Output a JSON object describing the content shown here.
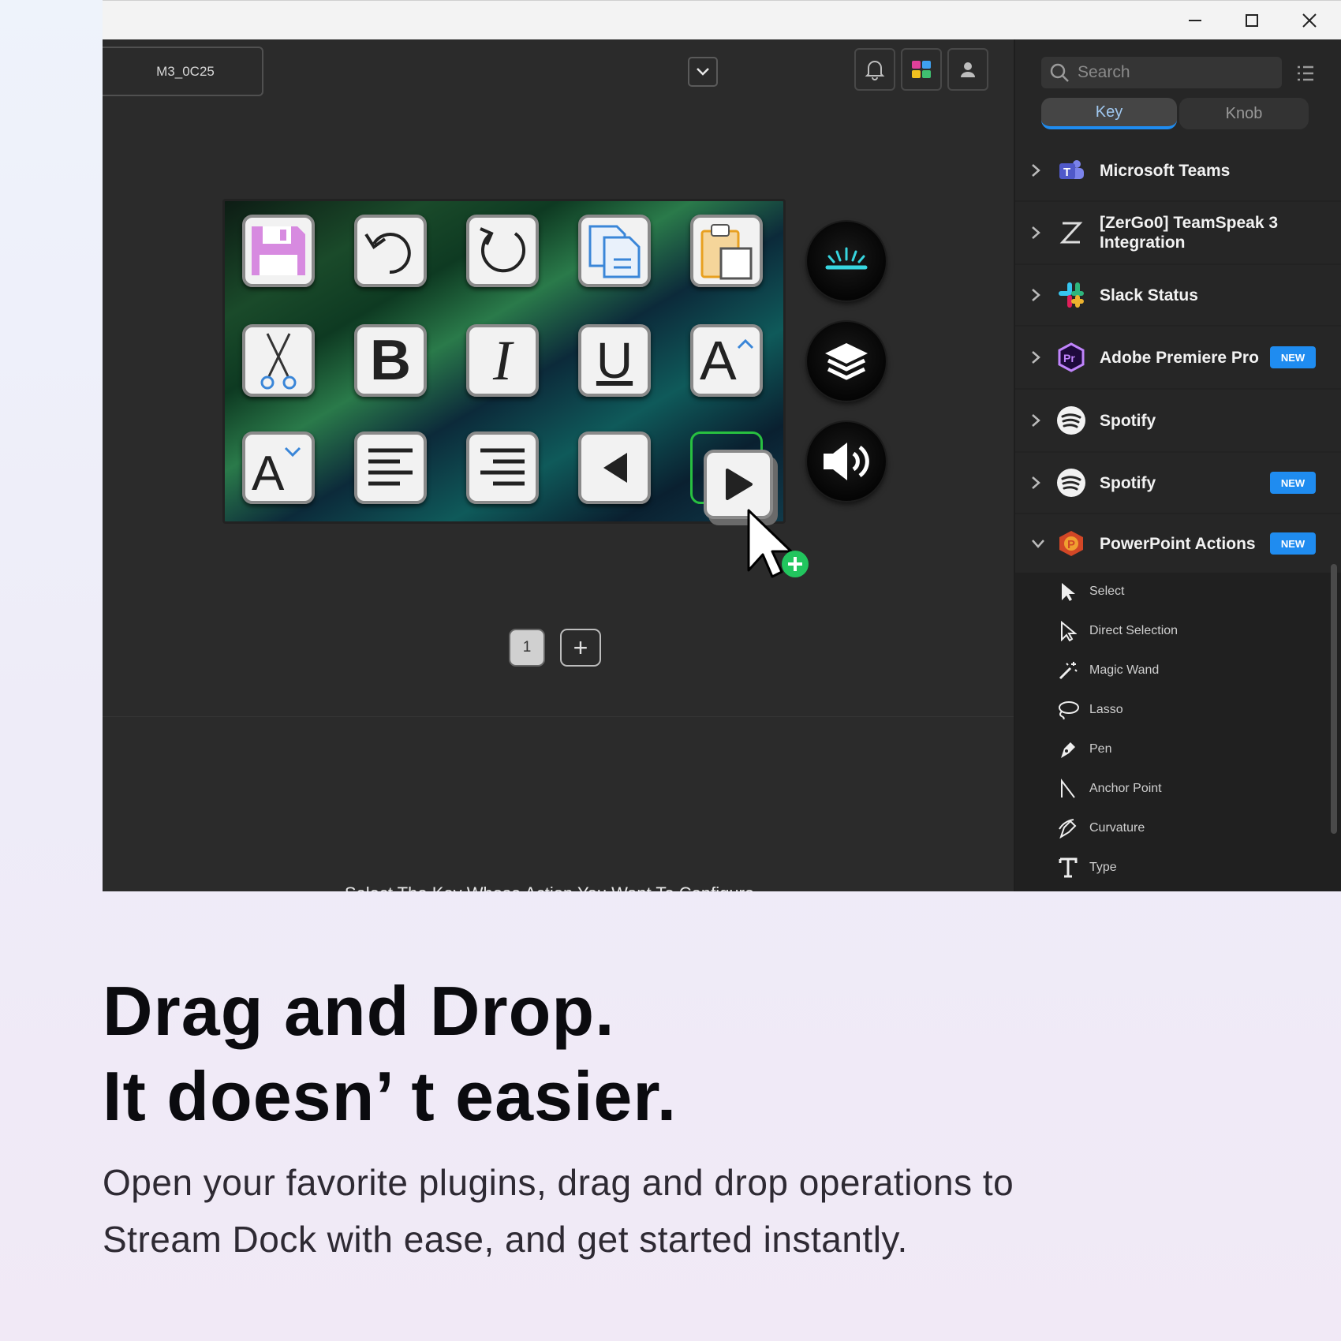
{
  "window": {
    "minimize_glyph": "─",
    "maximize_glyph": "☐",
    "close_glyph": "✕"
  },
  "header": {
    "device_name": "M3_0C25"
  },
  "keys": [
    {
      "icon": "save-icon"
    },
    {
      "icon": "undo-icon"
    },
    {
      "icon": "redo-icon"
    },
    {
      "icon": "copy-icon"
    },
    {
      "icon": "paste-icon"
    },
    {
      "icon": "cut-icon",
      "text": ""
    },
    {
      "icon": "bold-icon",
      "text": "B"
    },
    {
      "icon": "italic-icon",
      "text": "I"
    },
    {
      "icon": "underline-icon",
      "text": "U"
    },
    {
      "icon": "font-size-increase-icon",
      "text": "A"
    },
    {
      "icon": "font-size-decrease-icon",
      "text": "A"
    },
    {
      "icon": "align-left-icon"
    },
    {
      "icon": "align-right-icon"
    },
    {
      "icon": "previous-icon"
    },
    {
      "icon": "play-icon"
    }
  ],
  "knobs": [
    {
      "icon": "light-icon"
    },
    {
      "icon": "layers-icon"
    },
    {
      "icon": "volume-icon"
    }
  ],
  "pager": {
    "page": "1",
    "add": "+"
  },
  "hint": "Select The Key Whose Action You Want To Configure。",
  "panel": {
    "search_placeholder": "Search",
    "tabs": [
      "Key",
      "Knob"
    ],
    "plugins": [
      {
        "name": "Microsoft Teams",
        "badge": ""
      },
      {
        "name": "[ZerGo0] TeamSpeak 3 Integration",
        "badge": ""
      },
      {
        "name": "Slack Status",
        "badge": ""
      },
      {
        "name": "Adobe Premiere Pro",
        "badge": "NEW"
      },
      {
        "name": "Spotify",
        "badge": ""
      },
      {
        "name": "Spotify",
        "badge": "NEW"
      },
      {
        "name": "PowerPoint Actions",
        "badge": "NEW"
      }
    ],
    "actions": [
      "Select",
      "Direct Selection",
      "Magic Wand",
      "Lasso",
      "Pen",
      "Anchor Point",
      "Curvature",
      "Type"
    ]
  },
  "marketing": {
    "headline_line1": "Drag and Drop.",
    "headline_line2": "It doesn’ t easier.",
    "description_line1": "Open your favorite plugins, drag and drop operations to",
    "description_line2": "Stream Dock with ease, and get started instantly."
  },
  "colors": {
    "accent": "#1f8cf0",
    "drop_green": "#22c55e"
  }
}
